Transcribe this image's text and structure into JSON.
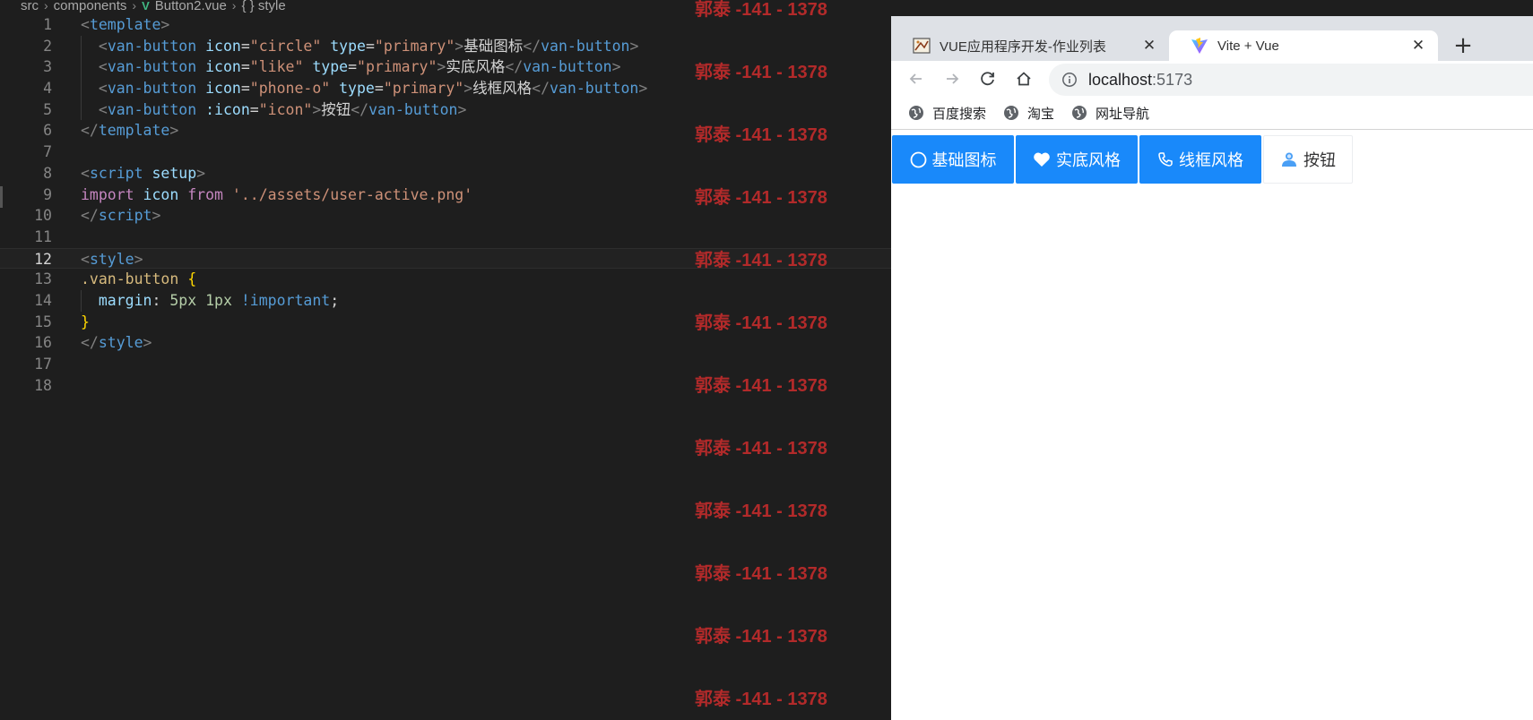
{
  "breadcrumb": {
    "parts": [
      "src",
      "components",
      "Button2.vue",
      "{ } style"
    ]
  },
  "editor": {
    "current_line": 12,
    "lines": [
      {
        "num": "1",
        "tokens": [
          [
            "t-punc",
            "<"
          ],
          [
            "t-tag",
            "template"
          ],
          [
            "t-punc",
            ">"
          ]
        ]
      },
      {
        "num": "2",
        "tokens": [
          [
            "t-text",
            "  "
          ],
          [
            "t-punc",
            "<"
          ],
          [
            "t-tag",
            "van-button"
          ],
          [
            "t-text",
            " "
          ],
          [
            "t-attr",
            "icon"
          ],
          [
            "t-text",
            "="
          ],
          [
            "t-str",
            "\"circle\""
          ],
          [
            "t-text",
            " "
          ],
          [
            "t-attr",
            "type"
          ],
          [
            "t-text",
            "="
          ],
          [
            "t-str",
            "\"primary\""
          ],
          [
            "t-punc",
            ">"
          ],
          [
            "t-text",
            "基础图标"
          ],
          [
            "t-punc",
            "</"
          ],
          [
            "t-tag",
            "van-button"
          ],
          [
            "t-punc",
            ">"
          ]
        ]
      },
      {
        "num": "3",
        "tokens": [
          [
            "t-text",
            "  "
          ],
          [
            "t-punc",
            "<"
          ],
          [
            "t-tag",
            "van-button"
          ],
          [
            "t-text",
            " "
          ],
          [
            "t-attr",
            "icon"
          ],
          [
            "t-text",
            "="
          ],
          [
            "t-str",
            "\"like\""
          ],
          [
            "t-text",
            " "
          ],
          [
            "t-attr",
            "type"
          ],
          [
            "t-text",
            "="
          ],
          [
            "t-str",
            "\"primary\""
          ],
          [
            "t-punc",
            ">"
          ],
          [
            "t-text",
            "实底风格"
          ],
          [
            "t-punc",
            "</"
          ],
          [
            "t-tag",
            "van-button"
          ],
          [
            "t-punc",
            ">"
          ]
        ]
      },
      {
        "num": "4",
        "tokens": [
          [
            "t-text",
            "  "
          ],
          [
            "t-punc",
            "<"
          ],
          [
            "t-tag",
            "van-button"
          ],
          [
            "t-text",
            " "
          ],
          [
            "t-attr",
            "icon"
          ],
          [
            "t-text",
            "="
          ],
          [
            "t-str",
            "\"phone-o\""
          ],
          [
            "t-text",
            " "
          ],
          [
            "t-attr",
            "type"
          ],
          [
            "t-text",
            "="
          ],
          [
            "t-str",
            "\"primary\""
          ],
          [
            "t-punc",
            ">"
          ],
          [
            "t-text",
            "线框风格"
          ],
          [
            "t-punc",
            "</"
          ],
          [
            "t-tag",
            "van-button"
          ],
          [
            "t-punc",
            ">"
          ]
        ]
      },
      {
        "num": "5",
        "tokens": [
          [
            "t-text",
            "  "
          ],
          [
            "t-punc",
            "<"
          ],
          [
            "t-tag",
            "van-button"
          ],
          [
            "t-text",
            " "
          ],
          [
            "t-attr",
            ":icon"
          ],
          [
            "t-text",
            "="
          ],
          [
            "t-str",
            "\"icon\""
          ],
          [
            "t-punc",
            ">"
          ],
          [
            "t-text",
            "按钮"
          ],
          [
            "t-punc",
            "</"
          ],
          [
            "t-tag",
            "van-button"
          ],
          [
            "t-punc",
            ">"
          ]
        ]
      },
      {
        "num": "6",
        "tokens": [
          [
            "t-punc",
            "</"
          ],
          [
            "t-tag",
            "template"
          ],
          [
            "t-punc",
            ">"
          ]
        ]
      },
      {
        "num": "7",
        "tokens": []
      },
      {
        "num": "8",
        "tokens": [
          [
            "t-punc",
            "<"
          ],
          [
            "t-tag",
            "script"
          ],
          [
            "t-text",
            " "
          ],
          [
            "t-attr",
            "setup"
          ],
          [
            "t-punc",
            ">"
          ]
        ]
      },
      {
        "num": "9",
        "tokens": [
          [
            "t-kw",
            "import"
          ],
          [
            "t-text",
            " "
          ],
          [
            "t-attr",
            "icon"
          ],
          [
            "t-text",
            " "
          ],
          [
            "t-kw",
            "from"
          ],
          [
            "t-text",
            " "
          ],
          [
            "t-str",
            "'../assets/user-active.png'"
          ]
        ]
      },
      {
        "num": "10",
        "tokens": [
          [
            "t-punc",
            "</"
          ],
          [
            "t-tag",
            "script"
          ],
          [
            "t-punc",
            ">"
          ]
        ]
      },
      {
        "num": "11",
        "tokens": []
      },
      {
        "num": "12",
        "tokens": [
          [
            "t-punc",
            "<"
          ],
          [
            "t-tag",
            "style"
          ],
          [
            "t-punc",
            ">"
          ]
        ]
      },
      {
        "num": "13",
        "tokens": [
          [
            "t-sel",
            ".van-button"
          ],
          [
            "t-text",
            " "
          ],
          [
            "t-brace",
            "{"
          ]
        ]
      },
      {
        "num": "14",
        "tokens": [
          [
            "t-text",
            "  "
          ],
          [
            "t-attr",
            "margin"
          ],
          [
            "t-text",
            ": "
          ],
          [
            "t-num",
            "5px"
          ],
          [
            "t-text",
            " "
          ],
          [
            "t-num",
            "1px"
          ],
          [
            "t-text",
            " "
          ],
          [
            "t-imp",
            "!important"
          ],
          [
            "t-text",
            ";"
          ]
        ]
      },
      {
        "num": "15",
        "tokens": [
          [
            "t-brace",
            "}"
          ]
        ]
      },
      {
        "num": "16",
        "tokens": [
          [
            "t-punc",
            "</"
          ],
          [
            "t-tag",
            "style"
          ],
          [
            "t-punc",
            ">"
          ]
        ]
      },
      {
        "num": "17",
        "tokens": []
      },
      {
        "num": "18",
        "tokens": []
      }
    ]
  },
  "watermark": {
    "text": "郭泰 -141 - 1378",
    "count": 12
  },
  "browser": {
    "tabs": [
      {
        "title": "VUE应用程序开发-作业列表",
        "active": false
      },
      {
        "title": "Vite + Vue",
        "active": true
      }
    ],
    "close_glyph": "✕",
    "new_tab_glyph": "+",
    "url": {
      "host": "localhost",
      "port": ":5173"
    },
    "bookmarks": [
      "百度搜索",
      "淘宝",
      "网址导航"
    ],
    "buttons": [
      {
        "label": "基础图标",
        "icon": "circle-icon",
        "type": "primary"
      },
      {
        "label": "实底风格",
        "icon": "heart-icon",
        "type": "primary"
      },
      {
        "label": "线框风格",
        "icon": "phone-icon",
        "type": "primary"
      },
      {
        "label": "按钮",
        "icon": "user-icon",
        "type": "default"
      }
    ],
    "colors": {
      "primary": "#1989fa",
      "watermark": "#b22a2a"
    }
  }
}
